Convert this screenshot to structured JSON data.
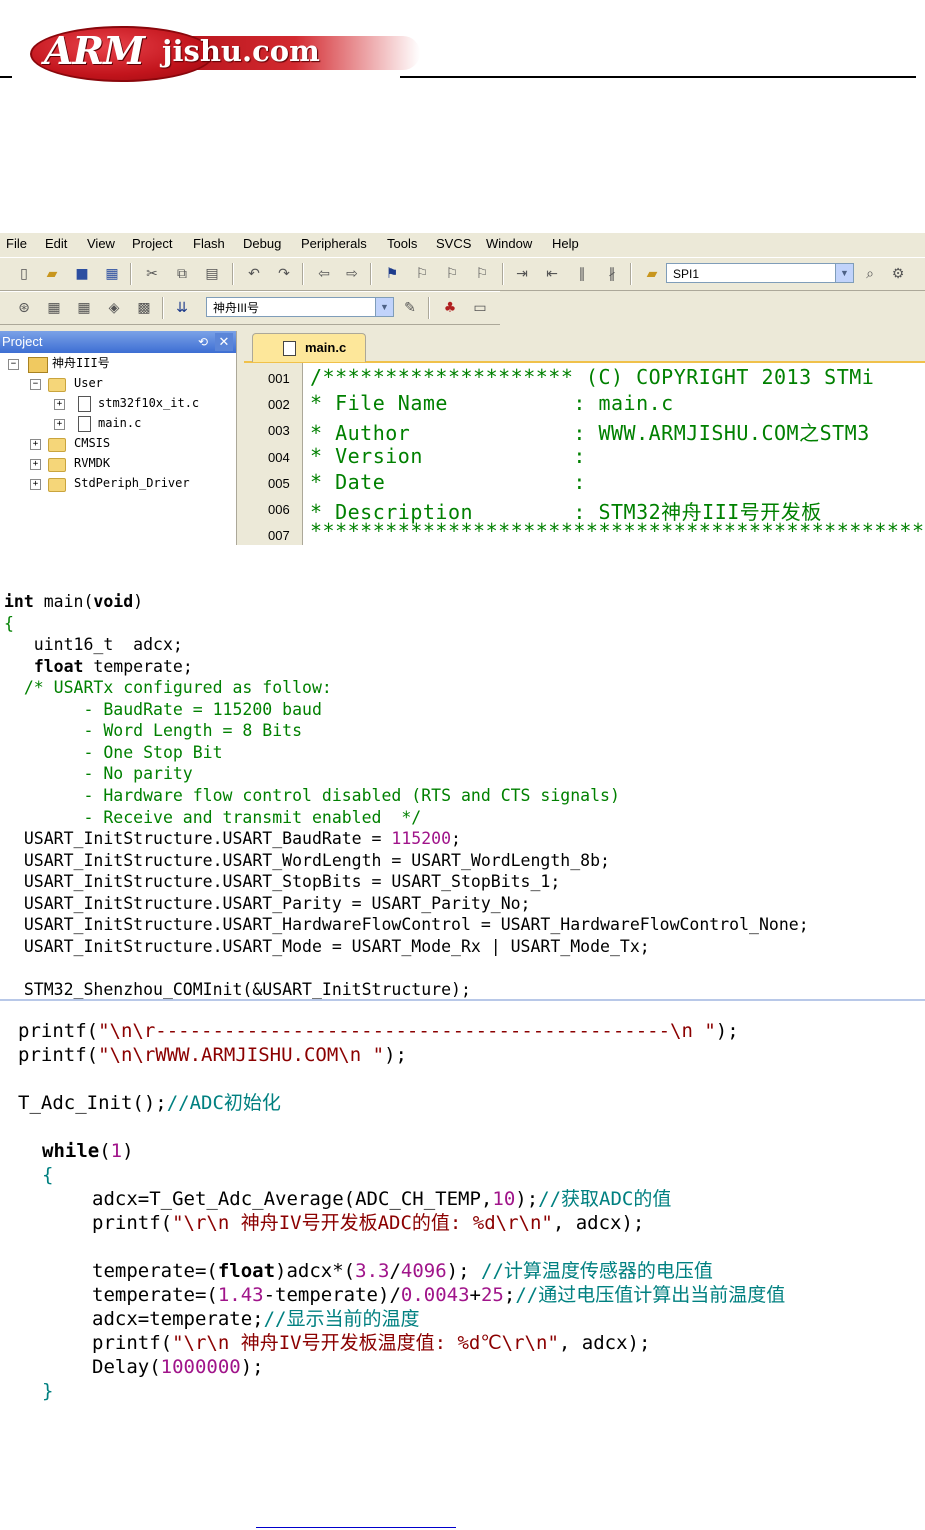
{
  "logo": {
    "arm": "ARM",
    "rest": "jishu.com"
  },
  "menu": [
    "File",
    "Edit",
    "View",
    "Project",
    "Flash",
    "Debug",
    "Peripherals",
    "Tools",
    "SVCS",
    "Window",
    "Help"
  ],
  "toolbar": {
    "target_combo": "SPI1",
    "project_combo": "神舟III号"
  },
  "project_pane": {
    "title": "Project",
    "tree": {
      "root": "神舟III号",
      "user": "User",
      "file1": "stm32f10x_it.c",
      "file2": "main.c",
      "cmsis": "CMSIS",
      "rvmdk": "RVMDK",
      "stdperiph": "StdPeriph_Driver"
    }
  },
  "editor": {
    "tab": "main.c",
    "line_numbers": [
      "001",
      "002",
      "003",
      "004",
      "005",
      "006",
      "007"
    ],
    "lines": [
      "/******************** (C) COPYRIGHT 2013 STMi",
      "* File Name          : main.c",
      "* Author             : WWW.ARMJISHU.COM之STM3",
      "* Version            :",
      "* Date               :",
      "* Description        : STM32神舟III号开发板",
      "*******************************************************"
    ]
  },
  "code1": {
    "l1_kw": "int",
    "l1_rest": " main(",
    "l1_void": "void",
    "l1_close": ")",
    "l2": "{",
    "l3": "   uint16_t  adcx;",
    "l4_kw": "float",
    "l4_rest": " temperate;",
    "c1": "  /* USARTx configured as follow:",
    "c2": "        - BaudRate = 115200 baud",
    "c3": "        - Word Length = 8 Bits",
    "c4": "        - One Stop Bit",
    "c5": "        - No parity",
    "c6": "        - Hardware flow control disabled (RTS and CTS signals)",
    "c7": "        - Receive and transmit enabled  */",
    "s1a": "  USART_InitStructure.USART_BaudRate = ",
    "s1n": "115200",
    "s1b": ";",
    "s2": "  USART_InitStructure.USART_WordLength = USART_WordLength_8b;",
    "s3": "  USART_InitStructure.USART_StopBits = USART_StopBits_1;",
    "s4": "  USART_InitStructure.USART_Parity = USART_Parity_No;",
    "s5": "  USART_InitStructure.USART_HardwareFlowControl = USART_HardwareFlowControl_None;",
    "s6": "  USART_InitStructure.USART_Mode = USART_Mode_Rx | USART_Mode_Tx;",
    "s7": "  STM32_Shenzhou_COMInit(&USART_InitStructure);"
  },
  "code2": {
    "p1a": "printf(",
    "p1s": "\"\\n\\r---------------------------------------------\\n \"",
    "p1b": ");",
    "p2a": "printf(",
    "p2s": "\"\\n\\rWWW.ARMJISHU.COM\\n \"",
    "p2b": ");",
    "t1a": "T_Adc_Init();",
    "t1c": "//ADC初始化",
    "w1a": "while",
    "w1b": "(",
    "w1n": "1",
    "w1c": ")",
    "w2": "{",
    "a1a": "adcx=T_Get_Adc_Average(ADC_CH_TEMP,",
    "a1n": "10",
    "a1b": ");",
    "a1c": "//获取ADC的值",
    "a2a": "printf(",
    "a2s": "\"\\r\\n 神舟IV号开发板ADC的值: %d\\r\\n\"",
    "a2b": ", adcx);",
    "a3a": "temperate=(",
    "a3k": "float",
    "a3b": ")adcx*(",
    "a3n1": "3.3",
    "a3d": "/",
    "a3n2": "4096",
    "a3e": ");",
    "a3c": " //计算温度传感器的电压值",
    "a4a": "temperate=(",
    "a4n1": "1.43",
    "a4b": "-temperate)/",
    "a4n2": "0.0043",
    "a4c2": "+",
    "a4n3": "25",
    "a4e": ";",
    "a4c": "//通过电压值计算出当前温度值",
    "a5a": "adcx=temperate;",
    "a5c": "//显示当前的温度",
    "a6a": "printf(",
    "a6s": "\"\\r\\n 神舟IV号开发板温度值: %d℃\\r\\n\"",
    "a6b": ", adcx);",
    "a7a": "Delay(",
    "a7n": "1000000",
    "a7b": ");",
    "w3": "}"
  }
}
